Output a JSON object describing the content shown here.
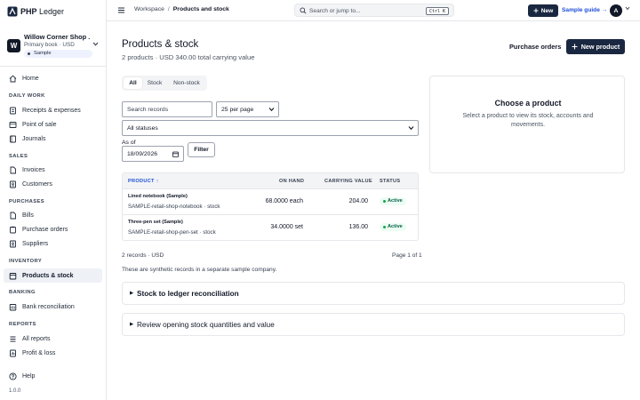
{
  "app": {
    "logo_bold": "PHP",
    "logo_rest": " Ledger",
    "version": "1.0.0"
  },
  "org": {
    "initial": "W",
    "name": "Willow Corner Shop ...",
    "subtitle": "Primary book · USD",
    "badge": "Sample"
  },
  "sidebar": {
    "home": "Home",
    "sections": {
      "daily_work": "DAILY WORK",
      "sales": "SALES",
      "purchases": "PURCHASES",
      "inventory": "INVENTORY",
      "banking": "BANKING",
      "reports": "REPORTS"
    },
    "items": {
      "receipts": "Receipts & expenses",
      "pos": "Point of sale",
      "journals": "Journals",
      "invoices": "Invoices",
      "customers": "Customers",
      "bills": "Bills",
      "purchase_orders": "Purchase orders",
      "suppliers": "Suppliers",
      "products": "Products & stock",
      "bank_rec": "Bank reconciliation",
      "all_reports": "All reports",
      "pnl": "Profit & loss",
      "help": "Help"
    }
  },
  "topbar": {
    "crumb_root": "Workspace",
    "crumb_sep": "/",
    "crumb_current": "Products and stock",
    "search_placeholder": "Search or jump to...",
    "search_kbd": "Ctrl K",
    "new_label": "New",
    "sample_guide": "Sample guide →",
    "user_initial": "A"
  },
  "page": {
    "title": "Products & stock",
    "subtitle": "2 products · USD 340.00 total carrying value",
    "purchase_orders": "Purchase orders",
    "new_product": "New product"
  },
  "tabs": [
    "All",
    "Stock",
    "Non-stock"
  ],
  "filters": {
    "search_placeholder": "Search records",
    "per_page": "25 per page",
    "status": "All statuses",
    "as_of_label": "As of",
    "as_of_value": "18/09/2026",
    "filter_button": "Filter"
  },
  "table": {
    "headers": {
      "product": "PRODUCT ↑",
      "on_hand": "ON HAND",
      "carrying_value": "CARRYING VALUE",
      "status": "STATUS"
    },
    "rows": [
      {
        "name": "Lined notebook (Sample)",
        "sku": "SAMPLE-retail-shop-notebook · stock",
        "on_hand": "68.0000 each",
        "carrying_value": "204.00",
        "status": "Active"
      },
      {
        "name": "Three-pen set (Sample)",
        "sku": "SAMPLE-retail-shop-pen-set · stock",
        "on_hand": "34.0000 set",
        "carrying_value": "136.00",
        "status": "Active"
      }
    ]
  },
  "footer": {
    "records": "2 records · USD",
    "pagination": "Page 1 of 1",
    "synthetic_note": "These are synthetic records in a separate sample company."
  },
  "sections": {
    "ledger_recon": "Stock to ledger reconciliation",
    "opening_stock": "Review opening stock quantities and value"
  },
  "side_panel": {
    "title": "Choose a product",
    "description": "Select a product to view its stock, accounts and movements."
  },
  "colors": {
    "primary": "#1a2740",
    "link": "#1d4ed8",
    "active_status": "#16a34a"
  }
}
